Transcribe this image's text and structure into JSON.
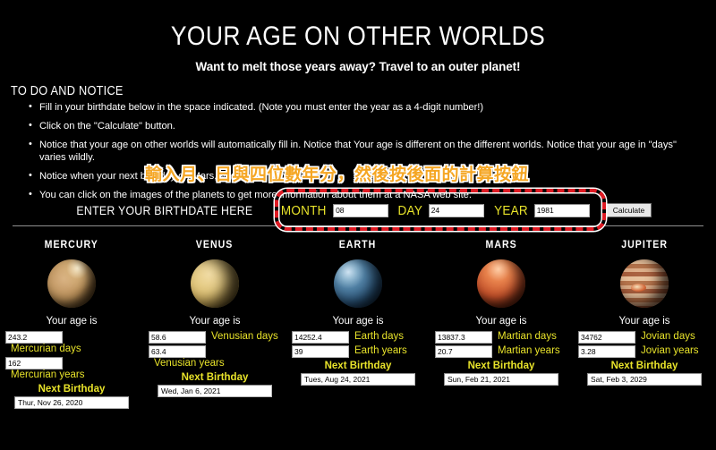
{
  "header": {
    "title": "YOUR AGE ON OTHER WORLDS",
    "subtitle": "Want to melt those years away? Travel to an outer planet!"
  },
  "todo": {
    "heading": "TO DO AND NOTICE",
    "items": [
      "Fill in your birthdate below in the space indicated. (Note you must enter the year as a 4-digit number!)",
      "Click on the \"Calculate\" button.",
      "Notice that your age on other worlds will automatically fill in. Notice that Your age is different on the different worlds. Notice that your age in \"days\" varies wildly.",
      "Notice when your next birthday on Mars, Venus and Jupiter are.",
      "You can click on the images of the planets to get more information about them at a NASA web site."
    ]
  },
  "annotation": {
    "text": "輸入月、日與四位數年分，然後按後面的計算按鈕",
    "color": "#f5a623",
    "highlight_color": "#e01b24"
  },
  "entry": {
    "label": "ENTER YOUR BIRTHDATE HERE",
    "month_label": "MONTH",
    "month_value": "08",
    "day_label": "DAY",
    "day_value": "24",
    "year_label": "YEAR",
    "year_value": "1981",
    "calculate_label": "Calculate"
  },
  "planets": [
    {
      "name": "MERCURY",
      "icon": "mercury-planet-icon",
      "age_is": "Your age is",
      "days_value": "243.2",
      "days_unit": "Mercurian days",
      "years_value": "162",
      "years_unit": "Mercurian years",
      "next_birthday_label": "Next Birthday",
      "next_birthday_value": "Thur, Nov 26, 2020"
    },
    {
      "name": "VENUS",
      "icon": "venus-planet-icon",
      "age_is": "Your age is",
      "days_value": "58.6",
      "days_unit": "Venusian days",
      "years_value": "63.4",
      "years_unit": "Venusian years",
      "next_birthday_label": "Next Birthday",
      "next_birthday_value": "Wed, Jan 6, 2021"
    },
    {
      "name": "EARTH",
      "icon": "earth-planet-icon",
      "age_is": "Your age is",
      "days_value": "14252.4",
      "days_unit": "Earth days",
      "years_value": "39",
      "years_unit": "Earth years",
      "next_birthday_label": "Next Birthday",
      "next_birthday_value": "Tues, Aug 24, 2021"
    },
    {
      "name": "MARS",
      "icon": "mars-planet-icon",
      "age_is": "Your age is",
      "days_value": "13837.3",
      "days_unit": "Martian days",
      "years_value": "20.7",
      "years_unit": "Martian years",
      "next_birthday_label": "Next Birthday",
      "next_birthday_value": "Sun, Feb 21, 2021"
    },
    {
      "name": "JUPITER",
      "icon": "jupiter-planet-icon",
      "age_is": "Your age is",
      "days_value": "34762",
      "days_unit": "Jovian days",
      "years_value": "3.28",
      "years_unit": "Jovian years",
      "next_birthday_label": "Next Birthday",
      "next_birthday_value": "Sat, Feb 3, 2029"
    }
  ]
}
